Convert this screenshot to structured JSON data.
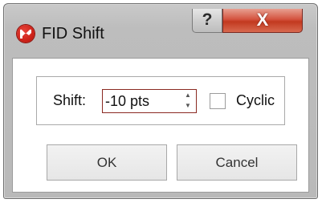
{
  "window": {
    "title": "FID Shift",
    "help_glyph": "?",
    "close_glyph": "X",
    "app_icon": "app-logo-icon",
    "accent_color": "#c81d14"
  },
  "form": {
    "shift_label": "Shift:",
    "shift_value": "-10 pts",
    "spin_up_glyph": "▲",
    "spin_down_glyph": "▼",
    "cyclic_label": "Cyclic",
    "cyclic_checked": false
  },
  "buttons": {
    "ok_label": "OK",
    "cancel_label": "Cancel"
  }
}
